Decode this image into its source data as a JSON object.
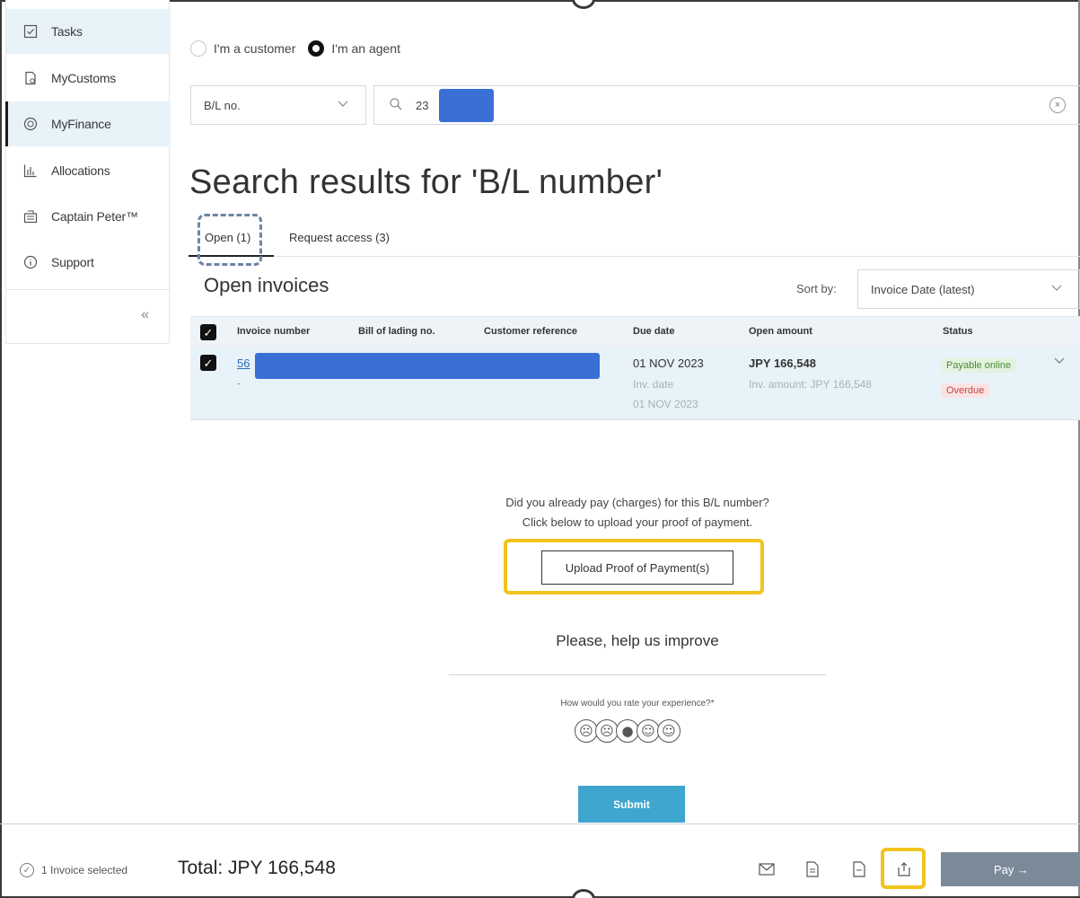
{
  "sidebar": {
    "items": [
      {
        "label": "Tasks",
        "icon": "checkbox-icon"
      },
      {
        "label": "MyCustoms",
        "icon": "document-icon"
      },
      {
        "label": "MyFinance",
        "icon": "finance-icon"
      },
      {
        "label": "Allocations",
        "icon": "bar-chart-icon"
      },
      {
        "label": "Captain Peter™",
        "icon": "container-icon"
      },
      {
        "label": "Support",
        "icon": "info-icon"
      }
    ],
    "collapse_glyph": "«"
  },
  "role": {
    "customer_label": "I'm a customer",
    "agent_label": "I'm an agent",
    "selected": "agent"
  },
  "search": {
    "type_value": "B/L no.",
    "query_prefix": "23",
    "clear_glyph": "×"
  },
  "results": {
    "title": "Search results for 'B/L number'"
  },
  "tabs": [
    {
      "label": "Open  (1)",
      "active": true
    },
    {
      "label": "Request access  (3)",
      "active": false
    }
  ],
  "invoices": {
    "heading": "Open invoices",
    "sort_label": "Sort by:",
    "sort_value": "Invoice Date (latest)",
    "columns": [
      "Invoice number",
      "Bill of lading no.",
      "Customer reference",
      "Due date",
      "Open amount",
      "Status"
    ],
    "rows": [
      {
        "invoice_number": "56",
        "invoice_sub": "-",
        "due_date": "01 NOV 2023",
        "inv_date_label": "Inv. date",
        "inv_date": "01 NOV 2023",
        "open_amount": "JPY 166,548",
        "inv_amount": "Inv. amount: JPY 166,548",
        "status_payable": "Payable online",
        "status_overdue": "Overdue"
      }
    ]
  },
  "proof": {
    "question_line1": "Did you already pay (charges) for this B/L number?",
    "question_line2": "Click below to upload your proof of payment.",
    "button_label": "Upload Proof of Payment(s)"
  },
  "feedback": {
    "title": "Please, help us improve",
    "question": "How would you rate your experience?*",
    "submit_label": "Submit"
  },
  "footer": {
    "selected_text": "1 Invoice selected",
    "total": "Total: JPY 166,548",
    "pay_label": "Pay  →"
  },
  "colors": {
    "highlight_yellow": "#f2c31b",
    "redaction_blue": "#3a6fd6",
    "submit_blue": "#3fa6cf",
    "pay_gray": "#7b8a99"
  }
}
